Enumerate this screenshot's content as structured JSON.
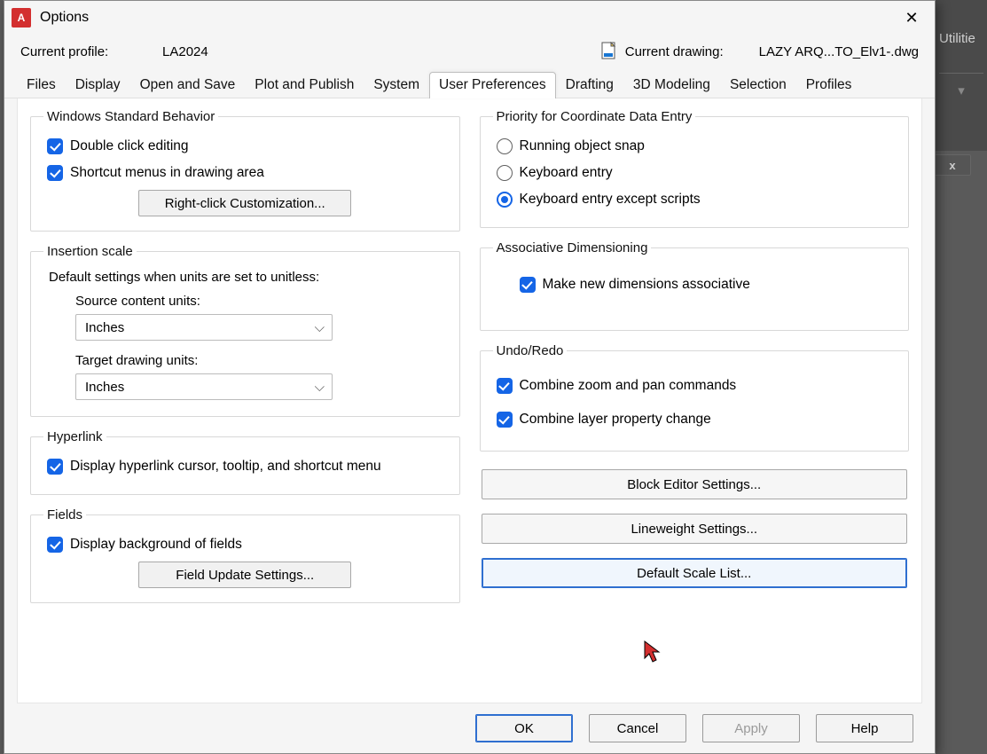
{
  "bg": {
    "utilities": "Utilitie",
    "chev": "▾",
    "x": "x"
  },
  "titlebar": {
    "app_letter": "A",
    "title": "Options",
    "close": "✕"
  },
  "info": {
    "cp_label": "Current profile:",
    "cp_value": "LA2024",
    "cd_label": "Current drawing:",
    "cd_value": "LAZY ARQ...TO_Elv1-.dwg"
  },
  "tabs": [
    {
      "label": "Files"
    },
    {
      "label": "Display"
    },
    {
      "label": "Open and Save"
    },
    {
      "label": "Plot and Publish"
    },
    {
      "label": "System"
    },
    {
      "label": "User Preferences"
    },
    {
      "label": "Drafting"
    },
    {
      "label": "3D Modeling"
    },
    {
      "label": "Selection"
    },
    {
      "label": "Profiles"
    }
  ],
  "wsb": {
    "legend": "Windows Standard Behavior",
    "dblclick": "Double click editing",
    "shortcut": "Shortcut menus in drawing area",
    "rcc_btn": "Right-click Customization..."
  },
  "ins": {
    "legend": "Insertion scale",
    "desc": "Default settings when units are set to unitless:",
    "src_label": "Source content units:",
    "src_value": "Inches",
    "tgt_label": "Target drawing units:",
    "tgt_value": "Inches"
  },
  "hyper": {
    "legend": "Hyperlink",
    "opt": "Display hyperlink cursor, tooltip, and shortcut menu"
  },
  "fields": {
    "legend": "Fields",
    "opt": "Display background of fields",
    "btn": "Field Update Settings..."
  },
  "prio": {
    "legend": "Priority for Coordinate Data Entry",
    "r1": "Running object snap",
    "r2": "Keyboard entry",
    "r3": "Keyboard entry except scripts"
  },
  "assoc": {
    "legend": "Associative Dimensioning",
    "opt": "Make new dimensions associative"
  },
  "undo": {
    "legend": "Undo/Redo",
    "c1": "Combine zoom and pan commands",
    "c2": "Combine layer property change"
  },
  "rbtns": {
    "block": "Block Editor Settings...",
    "lw": "Lineweight Settings...",
    "scale": "Default Scale List..."
  },
  "dlg": {
    "ok": "OK",
    "cancel": "Cancel",
    "apply": "Apply",
    "help": "Help"
  },
  "glyph": {
    "chev_down": "⌵"
  }
}
